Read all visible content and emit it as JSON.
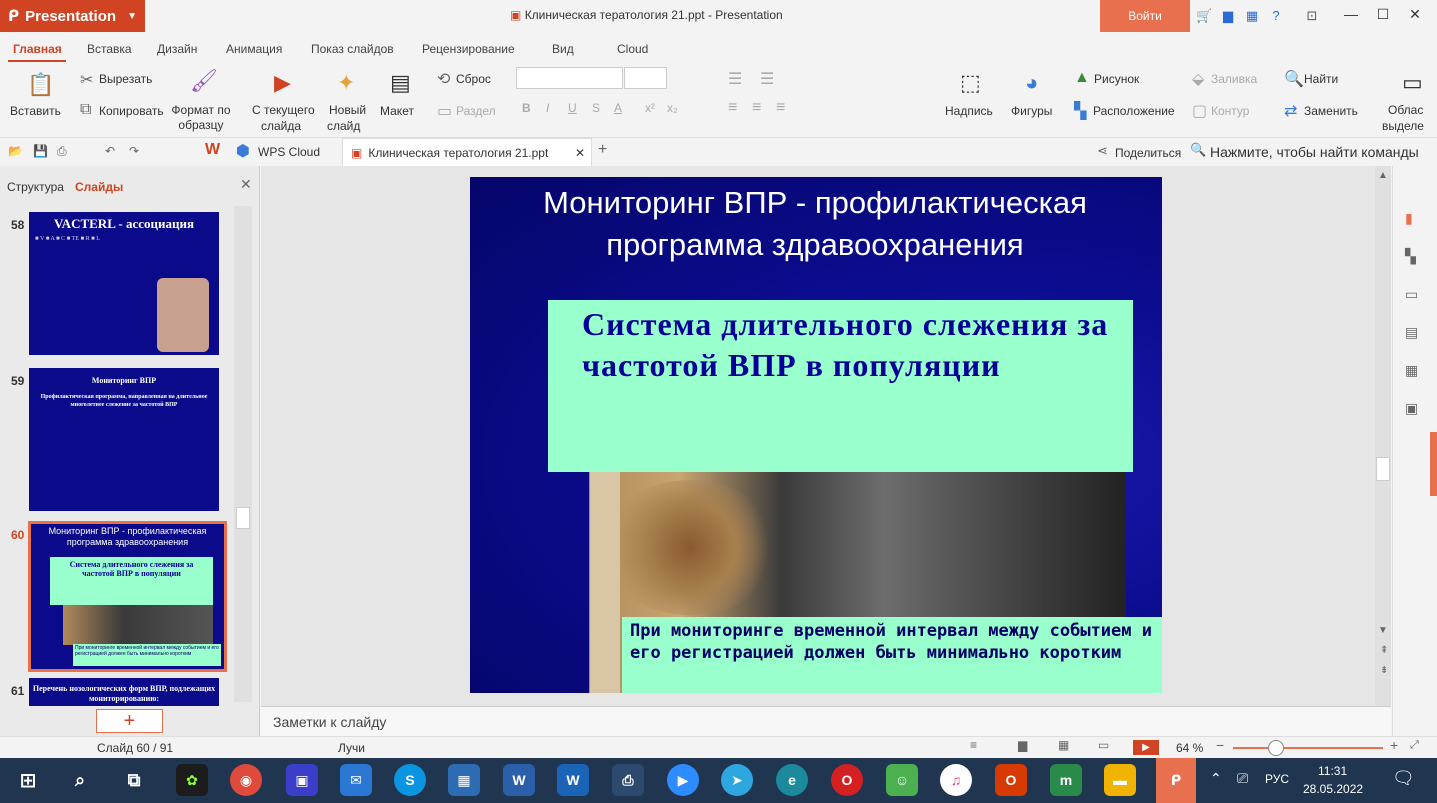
{
  "app": {
    "name": "Presentation",
    "doc_title": "Клиническая тератология 21.ppt - Presentation",
    "login": "Войти"
  },
  "tabs": [
    "Главная",
    "Вставка",
    "Дизайн",
    "Анимация",
    "Показ слайдов",
    "Рецензирование",
    "Вид",
    "Cloud"
  ],
  "ribbon": {
    "paste": "Вставить",
    "cut": "Вырезать",
    "copy": "Копировать",
    "format_painter": "Формат по образцу",
    "from_current_1": "С текущего",
    "from_current_2": "слайда",
    "new_slide_1": "Новый",
    "new_slide_2": "слайд",
    "layout": "Макет",
    "reset": "Сброс",
    "section": "Раздел",
    "textbox": "Надпись",
    "shapes": "Фигуры",
    "picture": "Рисунок",
    "arrange": "Расположение",
    "fill": "Заливка",
    "outline": "Контур",
    "find": "Найти",
    "replace": "Заменить",
    "area_1": "Облас",
    "area_2": "выделе",
    "bold": "B",
    "italic": "I",
    "underline": "U",
    "strike": "S",
    "fontcolor": "A",
    "sup": "x²",
    "sub": "x₂"
  },
  "quick": {
    "wps_cloud": "WPS Cloud",
    "doc_tab": "Клиническая тератология 21.ppt",
    "share": "Поделиться",
    "search": "Нажмите, чтобы найти команды"
  },
  "leftpanel": {
    "tab_outline": "Структура",
    "tab_slides": "Слайды",
    "thumbs": [
      {
        "num": "58",
        "title": "VACTERL - ассоциация"
      },
      {
        "num": "59",
        "title": "Мониторинг ВПР",
        "body": "Профилактическая программа, направленная на длительное многолетнее слежение за частотой ВПР"
      },
      {
        "num": "60",
        "title": "Мониторинг ВПР - профилактическая программа здравоохранения",
        "box": "Система длительного слежения за частотой ВПР в популяции",
        "bottom": "При мониторинге временной интервал между событием и его регистрацией должен быть минимально коротким"
      },
      {
        "num": "61",
        "title": "Перечень нозологических форм ВПР, подлежащих мониторированию:"
      }
    ]
  },
  "slide": {
    "title": "Мониторинг ВПР - профилактическая программа здравоохранения",
    "box_text": "Система длительного слежения  за частотой ВПР в популяции",
    "bottom_text": "При мониторинге временной интервал между событием и его регистрацией должен быть минимально коротким"
  },
  "notes_placeholder": "Заметки к слайду",
  "status": {
    "slide_counter": "Слайд 60 / 91",
    "theme": "Лучи",
    "zoom": "64 %"
  },
  "taskbar": {
    "lang": "РУС",
    "time": "11:31",
    "date": "28.05.2022"
  }
}
